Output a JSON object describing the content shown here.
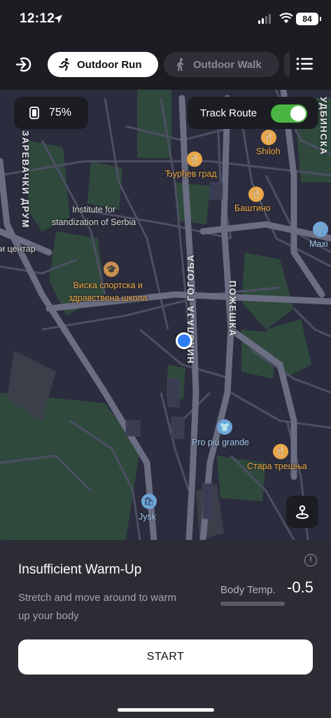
{
  "status_bar": {
    "time": "12:12",
    "battery": "84"
  },
  "nav": {
    "tabs": [
      {
        "label": "Outdoor Run",
        "active": true
      },
      {
        "label": "Outdoor Walk",
        "active": false
      }
    ]
  },
  "map": {
    "device_battery": "75%",
    "track_route_label": "Track Route",
    "track_route_on": true,
    "labels": {
      "institute": "Institute for\nstandization of Serbia",
      "school": "Виска спортска и\nздравствена школа",
      "center": "и центар",
      "djurdjev": "Ђурђев град",
      "shiloh": "Shiloh",
      "bashtino": "Баштино",
      "maxi": "Maxi",
      "pro_piu": "Pro più grande",
      "stara": "Стара трешња",
      "jysk": "Jysk",
      "street_zarevachki": "ЗАРЕВАЧКИ ДРУМ",
      "street_gogolja": "НИКОЛАЈА ГОГОЉА",
      "street_pozheshka": "ПОЖЕШКА",
      "street_udbinska": "УДБИНСКА"
    }
  },
  "panel": {
    "title": "Insufficient Warm-Up",
    "subtitle": "Stretch and move around to warm up your body",
    "temp_label": "Body Temp.",
    "temp_value": "-0.5",
    "start_label": "START"
  },
  "colors": {
    "accent_green": "#4bb543",
    "poi_food": "#e9a74a",
    "user_location": "#2f7bf0"
  }
}
